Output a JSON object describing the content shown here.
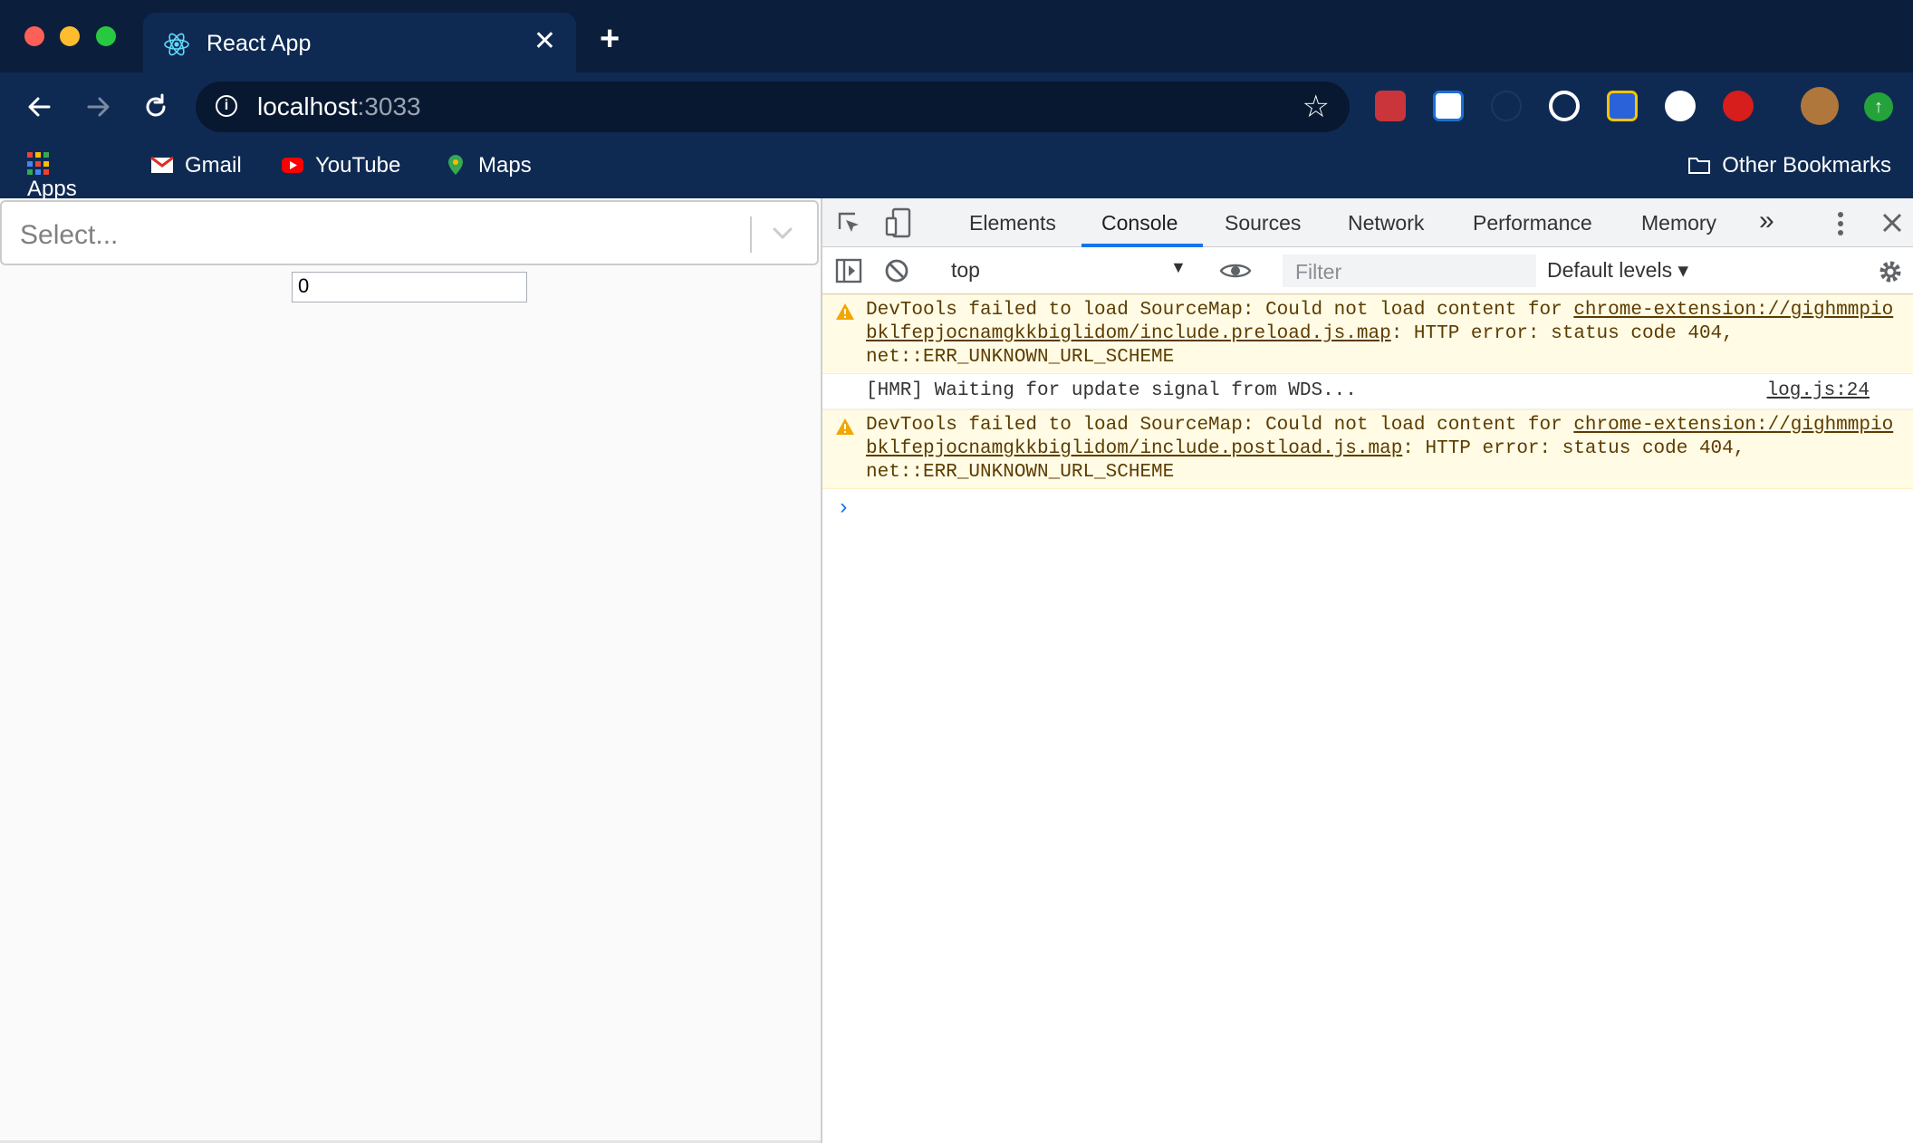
{
  "browser": {
    "tab": {
      "title": "React App",
      "close": "✕"
    },
    "new_tab": "+",
    "address": {
      "host": "localhost",
      "port": ":3033"
    },
    "bookmarks": {
      "apps": "Apps",
      "gmail": "Gmail",
      "youtube": "YouTube",
      "maps": "Maps",
      "other": "Other Bookmarks"
    }
  },
  "page": {
    "select_placeholder": "Select...",
    "number_value": "0"
  },
  "devtools": {
    "tabs": [
      "Elements",
      "Console",
      "Sources",
      "Network",
      "Performance",
      "Memory"
    ],
    "active_tab": "Console",
    "more": "»",
    "context": "top",
    "filter_placeholder": "Filter",
    "levels": "Default levels ▾",
    "messages": [
      {
        "type": "warning",
        "text_before": "DevTools failed to load SourceMap: Could not load content for ",
        "link": "chrome-extension://gighmmpiobklfepjocnamgkkbiglidom/include.preload.js.map",
        "text_after": ": HTTP error: status code 404, net::ERR_UNKNOWN_URL_SCHEME"
      },
      {
        "type": "info",
        "text": "[HMR] Waiting for update signal from WDS...",
        "source": "log.js:24"
      },
      {
        "type": "warning",
        "text_before": "DevTools failed to load SourceMap: Could not load content for ",
        "link": "chrome-extension://gighmmpiobklfepjocnamgkkbiglidom/include.postload.js.map",
        "text_after": ": HTTP error: status code 404, net::ERR_UNKNOWN_URL_SCHEME"
      }
    ],
    "prompt": "›"
  },
  "colors": {
    "chrome_bg": "#0f2a52",
    "devtools_accent": "#1a73e8",
    "warning_bg": "#fffbe5"
  }
}
